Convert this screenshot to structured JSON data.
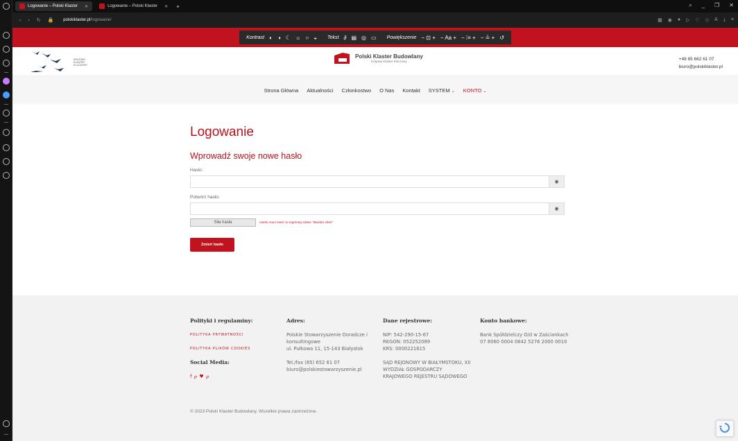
{
  "browser": {
    "tabs": [
      {
        "label": "Logowanie – Polski Klaster",
        "active": true
      },
      {
        "label": "Logowanie – Polski Klaster",
        "active": false
      }
    ],
    "new_tab": "+",
    "url_domain": "polskiklaster.pl",
    "url_path": "/logowanie/"
  },
  "accessibility": {
    "kontrast_label": "Kontrast",
    "tekst_label": "Tekst",
    "powiekszenie_label": "Powiększenie",
    "controls": [
      "− ⊡ +",
      "− Aa +",
      "− ⁞≡ +",
      "− ≟ +"
    ]
  },
  "header": {
    "left_logo_text": [
      "KRAJOWY",
      "KLASTER",
      "KLUCZOWY"
    ],
    "center_logo_title": "Polski Klaster Budowlany",
    "center_logo_subtitle": "Krajowy Klaster Kluczowy",
    "phone": "+48 85 662 61 07",
    "email": "biuro@polskiklaster.pl"
  },
  "nav": {
    "items": [
      "Strona Główna",
      "Aktualności",
      "Członkostwo",
      "O Nas",
      "Kontakt"
    ],
    "system": "SYSTEM",
    "konto": "KONTO"
  },
  "main": {
    "title": "Logowanie",
    "subtitle": "Wprowadź swoje nowe hasło",
    "password_label": "Hasło:",
    "confirm_label": "Potwórz hasło:",
    "strength_label": "Siła hasła",
    "strength_hint": "Hasło musi mieć co najmniej status \"Bardzo silne\"",
    "submit_label": "Zmień hasło"
  },
  "footer": {
    "col1": {
      "heading": "Polityki i regulaminy:",
      "link1": "POLITYKA PRYWATNOŚCI",
      "link2": "POLITYKA PLIKÓW COOKIES",
      "social_heading": "Social Media:"
    },
    "col2": {
      "heading": "Adres:",
      "line1": "Polskie Stowarzyszenie Doradcze i konsultingowe",
      "line2": "ul. Pułkowa 11, 15-143 Białystok",
      "line3": "Tel./fax (85) 652 61 07",
      "line4": "biuro@polskiestowarzyszenie.pl"
    },
    "col3": {
      "heading": "Dane rejestrowe:",
      "nip": "NIP: 542-290-15-67",
      "regon": "REGON: 052252089",
      "krs": "KRS: 0000221615",
      "court": "SĄD REJONOWY W BIAŁYMSTOKU, XII WYDZIAŁ GOSPODARCZY KRAJOWEGO REJESTRU SĄDOWEGO"
    },
    "col4": {
      "heading": "Konto bankowe:",
      "bank": "Bank Spółdzielczy O/d w Zaściankach 07 8060 0004 0842 5276 2000 0010"
    },
    "copyright": "© 2023 Polski Klaster Budowlany. Wszelkie prawa zastrzeżone."
  },
  "colors": {
    "accent": "#c1121f",
    "dark": "#2a2a2a"
  }
}
